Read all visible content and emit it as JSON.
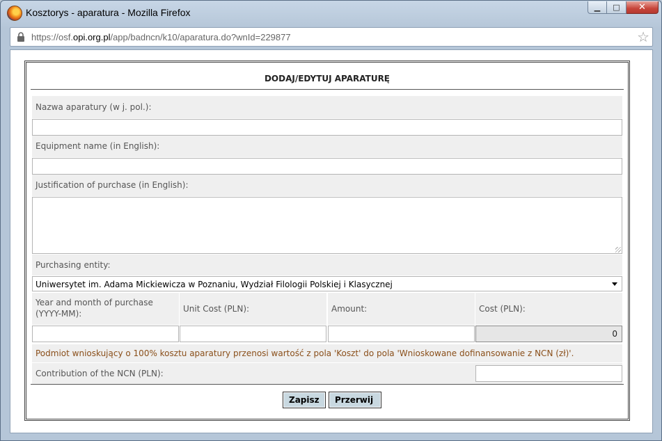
{
  "window": {
    "title": "Kosztorys - aparatura - Mozilla Firefox",
    "minimize_symbol": "▁",
    "maximize_symbol": "□",
    "close_symbol": "✕"
  },
  "urlbar": {
    "prefix": "https://osf.",
    "domain": "opi.org.pl",
    "path": "/app/badncn/k10/aparatura.do?wnId=229877"
  },
  "form": {
    "title": "DODAJ/EDYTUJ APARATURĘ",
    "name_pl_label": "Nazwa aparatury (w j. pol.):",
    "name_pl_value": "",
    "name_en_label": "Equipment name (in English):",
    "name_en_value": "",
    "justification_label": "Justification of purchase (in English):",
    "justification_value": "",
    "entity_label": "Purchasing entity:",
    "entity_selected": "Uniwersytet im. Adama Mickiewicza w Poznaniu, Wydział Filologii Polskiej i Klasycznej",
    "year_label": "Year and month of purchase (YYYY-MM):",
    "unit_cost_label": "Unit Cost (PLN):",
    "amount_label": "Amount:",
    "cost_label": "Cost (PLN):",
    "year_value": "",
    "unit_cost_value": "",
    "amount_value": "",
    "cost_value": "0",
    "note": "Podmiot wnioskujący o 100% kosztu aparatury przenosi wartość z pola 'Koszt' do pola 'Wnioskowane dofinansowanie z NCN (zł)'.",
    "contribution_label": "Contribution of the NCN (PLN):",
    "contribution_value": ""
  },
  "buttons": {
    "save": "Zapisz",
    "cancel": "Przerwij"
  }
}
